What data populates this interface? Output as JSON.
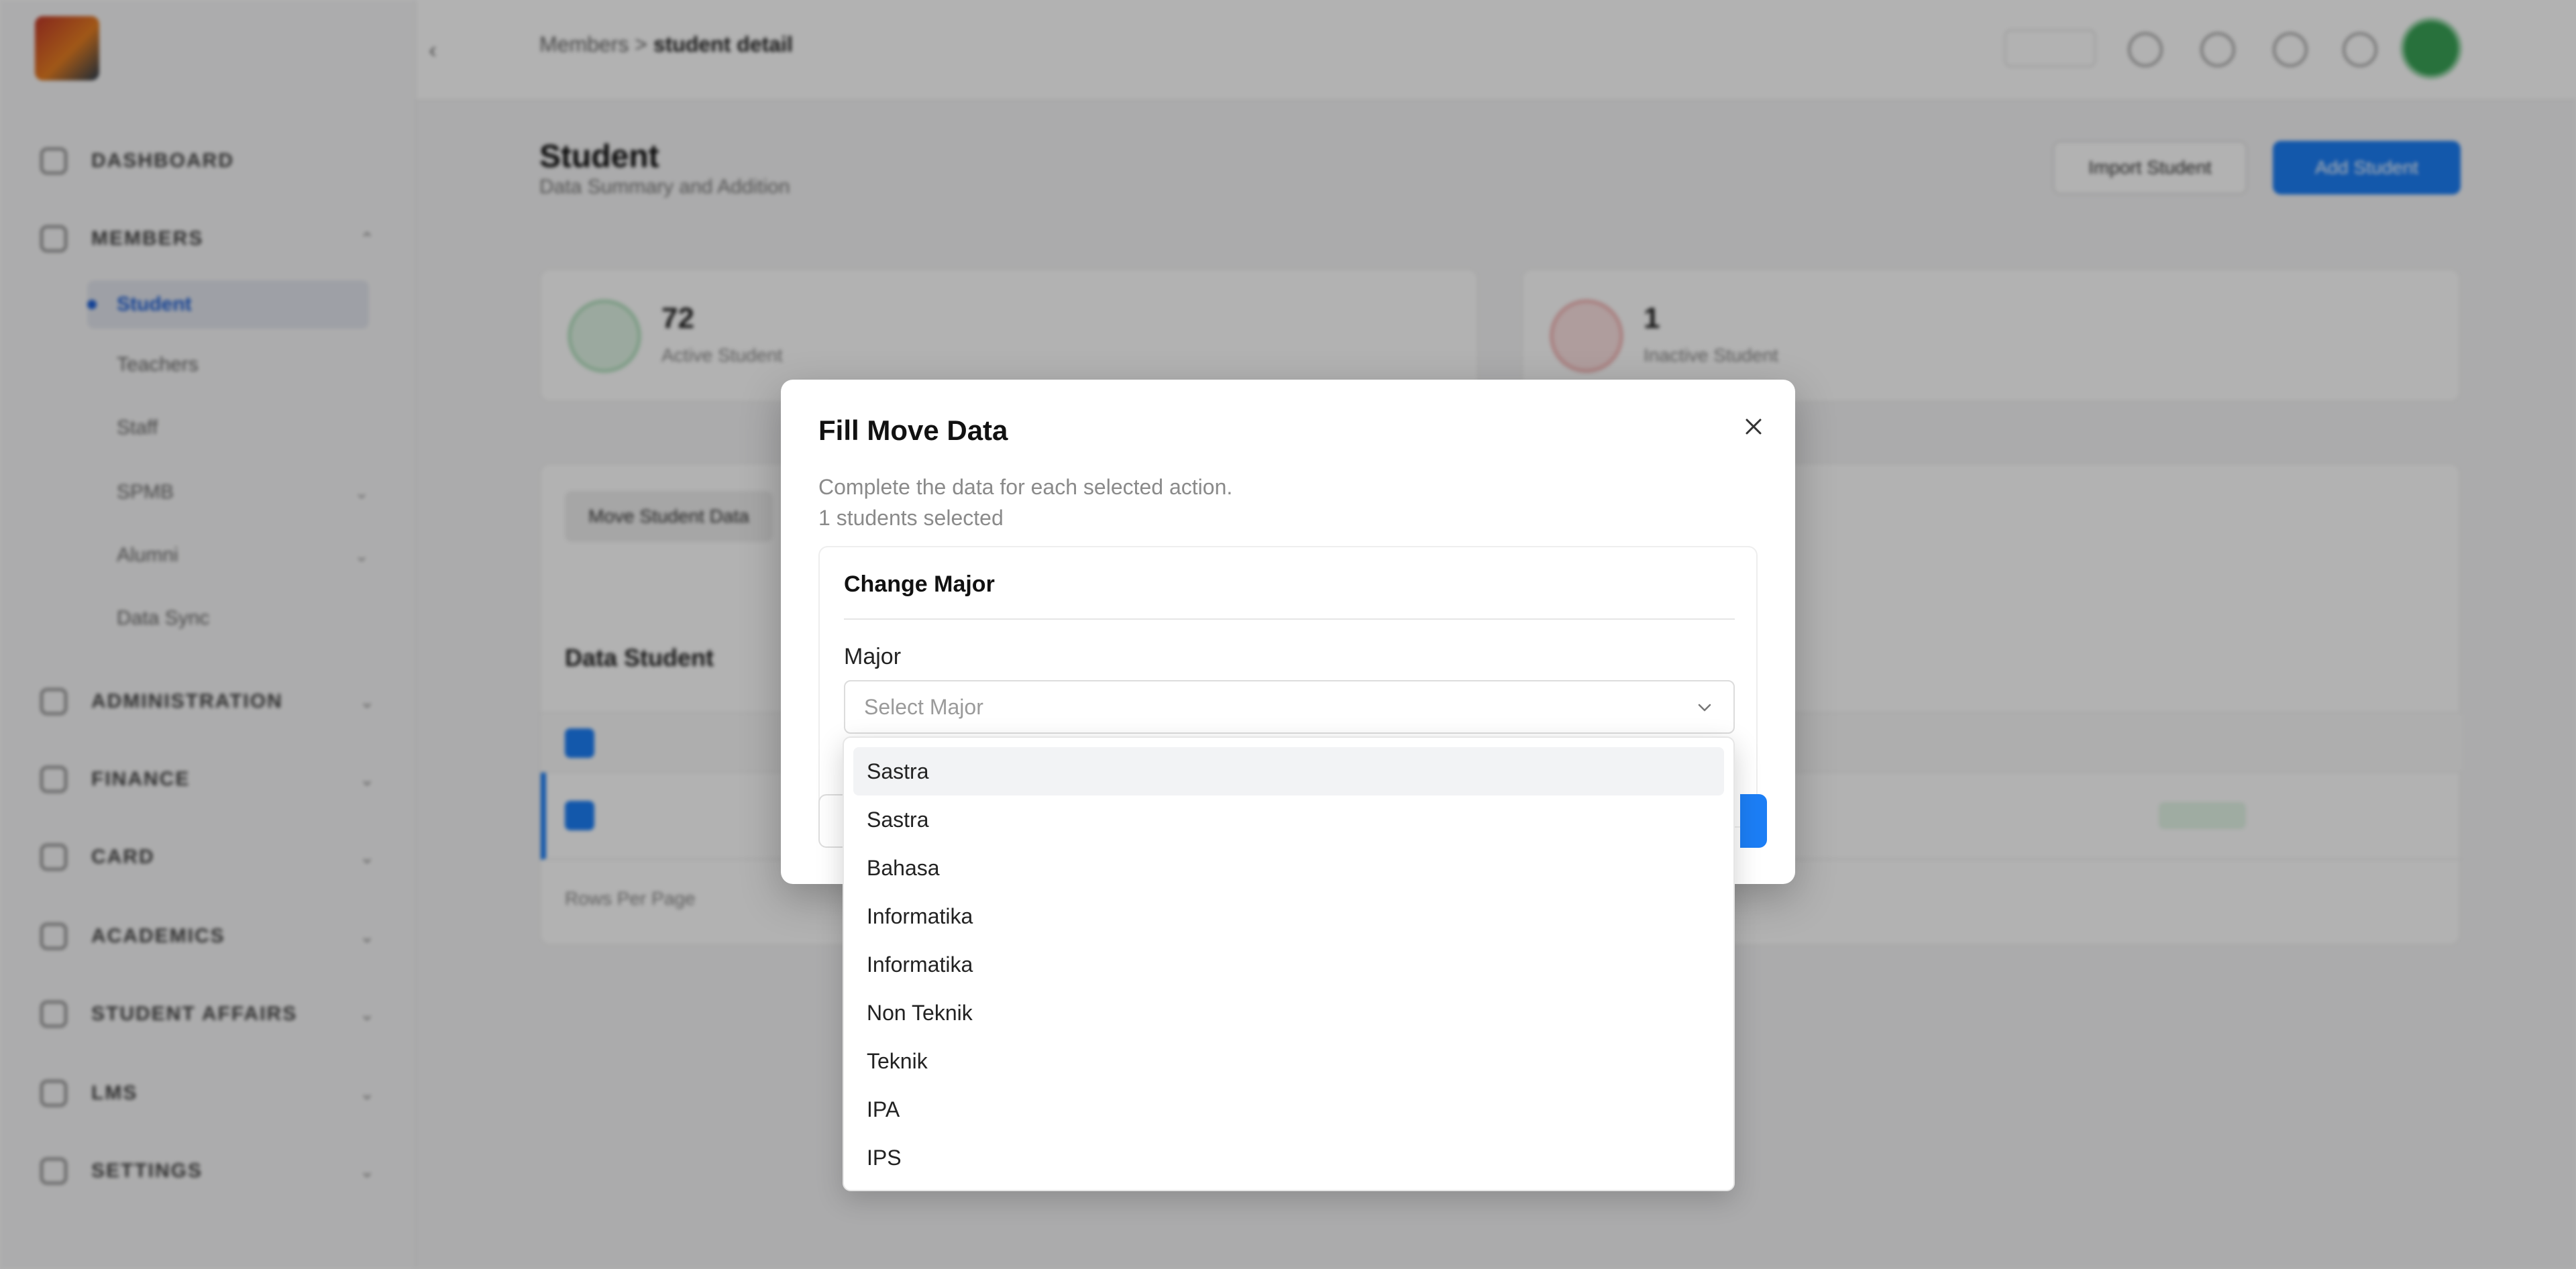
{
  "sidebar": {
    "items": [
      {
        "label": "DASHBOARD"
      },
      {
        "label": "MEMBERS"
      },
      {
        "label": "ADMINISTRATION"
      },
      {
        "label": "FINANCE"
      },
      {
        "label": "CARD"
      },
      {
        "label": "ACADEMICS"
      },
      {
        "label": "STUDENT AFFAIRS"
      },
      {
        "label": "LMS"
      },
      {
        "label": "SETTINGS"
      }
    ],
    "members_sub": [
      {
        "label": "Student"
      },
      {
        "label": "Teachers"
      },
      {
        "label": "Staff"
      },
      {
        "label": "SPMB"
      },
      {
        "label": "Alumni"
      },
      {
        "label": "Data Sync"
      }
    ]
  },
  "topbar": {
    "breadcrumb_parent": "Members",
    "breadcrumb_current": "student detail"
  },
  "page": {
    "title": "Student",
    "subtitle": "Data Summary and Addition",
    "import_label": "Import Student",
    "add_label": "Add Student"
  },
  "stats": [
    {
      "value": "72",
      "label": "Active Student"
    },
    {
      "value": "1",
      "label": "Inactive Student"
    }
  ],
  "table": {
    "tab_label": "Move Student Data",
    "title": "Data Student",
    "rows_label": "Rows Per Page"
  },
  "modal": {
    "title": "Fill Move Data",
    "description": "Complete the data for each selected action.",
    "selected_count": "1 students selected",
    "section_title": "Change Major",
    "field_label": "Major",
    "select_placeholder": "Select Major"
  },
  "dropdown": {
    "options": [
      "Sastra",
      "Sastra",
      "Bahasa",
      "Informatika",
      "Informatika",
      "Non Teknik",
      "Teknik",
      "IPA",
      "IPS"
    ]
  },
  "colors": {
    "accent": "#1c7ef5",
    "overlay": "rgba(0,0,0,0.30)"
  }
}
